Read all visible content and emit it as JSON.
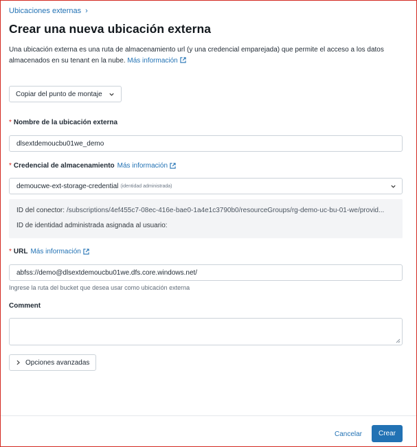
{
  "breadcrumb": {
    "parent": "Ubicaciones externas",
    "separator": "›"
  },
  "page": {
    "title": "Crear una nueva ubicación externa",
    "description": "Una ubicación externa es una ruta de almacenamiento url (y una credencial emparejada) que permite el acceso a los datos almacenados en su tenant en la nube.",
    "description_link": "Más información"
  },
  "mount_dropdown": {
    "label": "Copiar del punto de montaje"
  },
  "form": {
    "name": {
      "required_mark": "*",
      "label": "Nombre de la ubicación externa",
      "value": "dlsextdemoucbu01we_demo"
    },
    "credential": {
      "required_mark": "*",
      "label": "Credencial de almacenamiento",
      "link": "Más información",
      "value": "demoucwe-ext-storage-credential",
      "value_note": "(identidad administrada)",
      "info": {
        "connector_label": "ID del conector:",
        "connector_value": "/subscriptions/4ef455c7-08ec-416e-bae0-1a4e1c3790b0/resourceGroups/rg-demo-uc-bu-01-we/provid...",
        "identity_label": "ID de identidad administrada asignada al usuario:"
      }
    },
    "url": {
      "required_mark": "*",
      "label": "URL",
      "link": "Más información",
      "value": "abfss://demo@dlsextdemoucbu01we.dfs.core.windows.net/",
      "hint": "Ingrese la ruta del bucket que desea usar como ubicación externa"
    },
    "comment": {
      "label": "Comment",
      "value": ""
    },
    "advanced": {
      "label": "Opciones avanzadas"
    }
  },
  "footer": {
    "cancel": "Cancelar",
    "create": "Crear"
  },
  "colors": {
    "accent": "#2272b4",
    "required": "#d2281e",
    "border": "#cbd2d9"
  },
  "icons": {
    "breadcrumb_separator": "chevron-right-icon",
    "external_link": "external-link-icon",
    "dropdown": "chevron-down-icon",
    "advanced": "chevron-right-icon",
    "resize": "resize-handle-icon"
  }
}
